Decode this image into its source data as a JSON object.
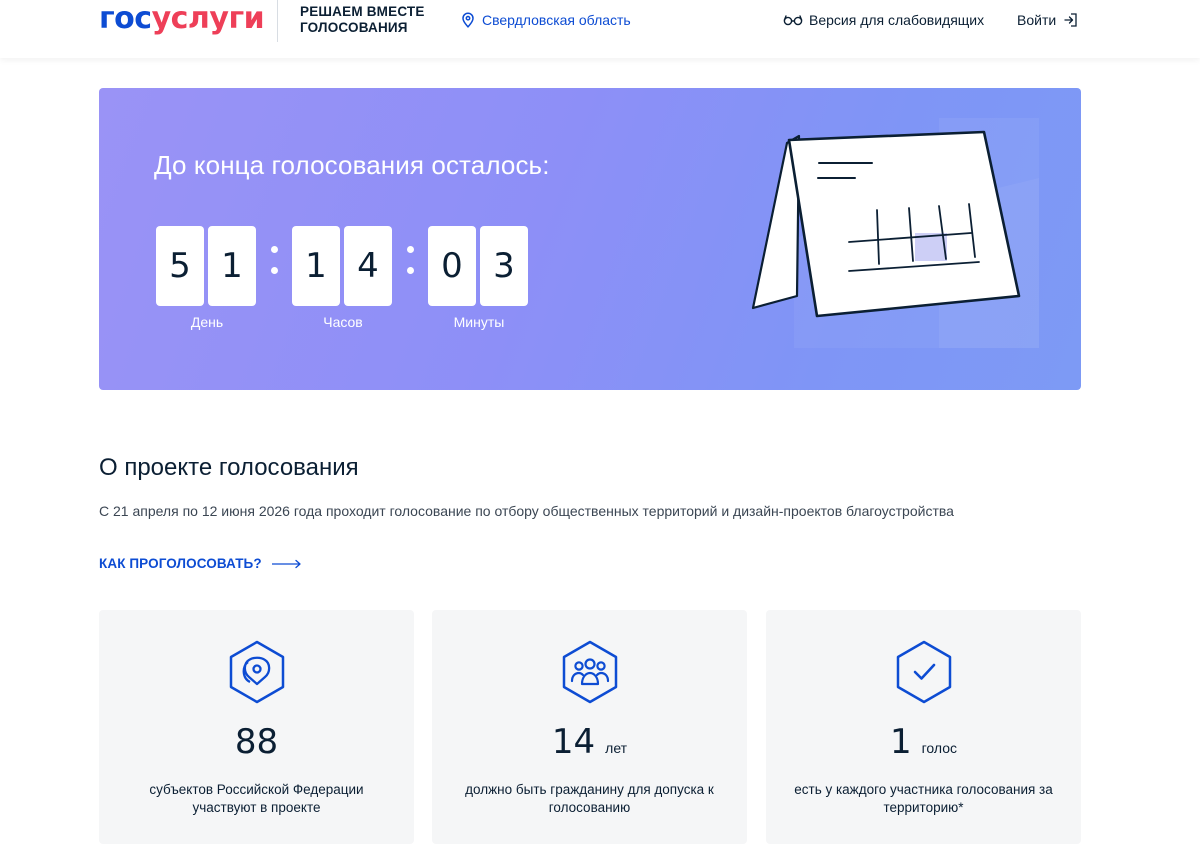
{
  "header": {
    "logo_part1": "гос",
    "logo_part2": "услуги",
    "project_title": "РЕШАЕМ ВМЕСТЕ\nГОЛОСОВАНИЯ",
    "region": "Свердловская область",
    "accessibility": "Версия для слабовидящих",
    "login": "Войти"
  },
  "banner": {
    "title": "До конца голосования осталось:",
    "days_digits": [
      "5",
      "1"
    ],
    "hours_digits": [
      "1",
      "4"
    ],
    "minutes_digits": [
      "0",
      "3"
    ],
    "days_label": "День",
    "hours_label": "Часов",
    "minutes_label": "Минуты"
  },
  "about": {
    "title": "О проекте голосования",
    "text": "С 21 апреля по 12 июня 2026 года проходит голосование по отбору общественных территорий и дизайн-проектов благоустройства",
    "how_link": "КАК ПРОГОЛОСОВАТЬ?"
  },
  "stats": [
    {
      "icon": "map-pin-icon",
      "value": "88",
      "suffix": "",
      "description": "субъектов Российской Федерации участвуют в проекте"
    },
    {
      "icon": "group-icon",
      "value": "14",
      "suffix": "лет",
      "description": "должно быть гражданину для допуска к голосованию"
    },
    {
      "icon": "checkmark-icon",
      "value": "1",
      "suffix": "голос",
      "description": "есть у каждого участника голосования за территорию*"
    }
  ],
  "colors": {
    "brand_blue": "#0d4cd3",
    "brand_red": "#ee3f58",
    "banner_start": "#9a93f6",
    "banner_end": "#7d9af5",
    "card_bg": "#f5f6f7"
  }
}
